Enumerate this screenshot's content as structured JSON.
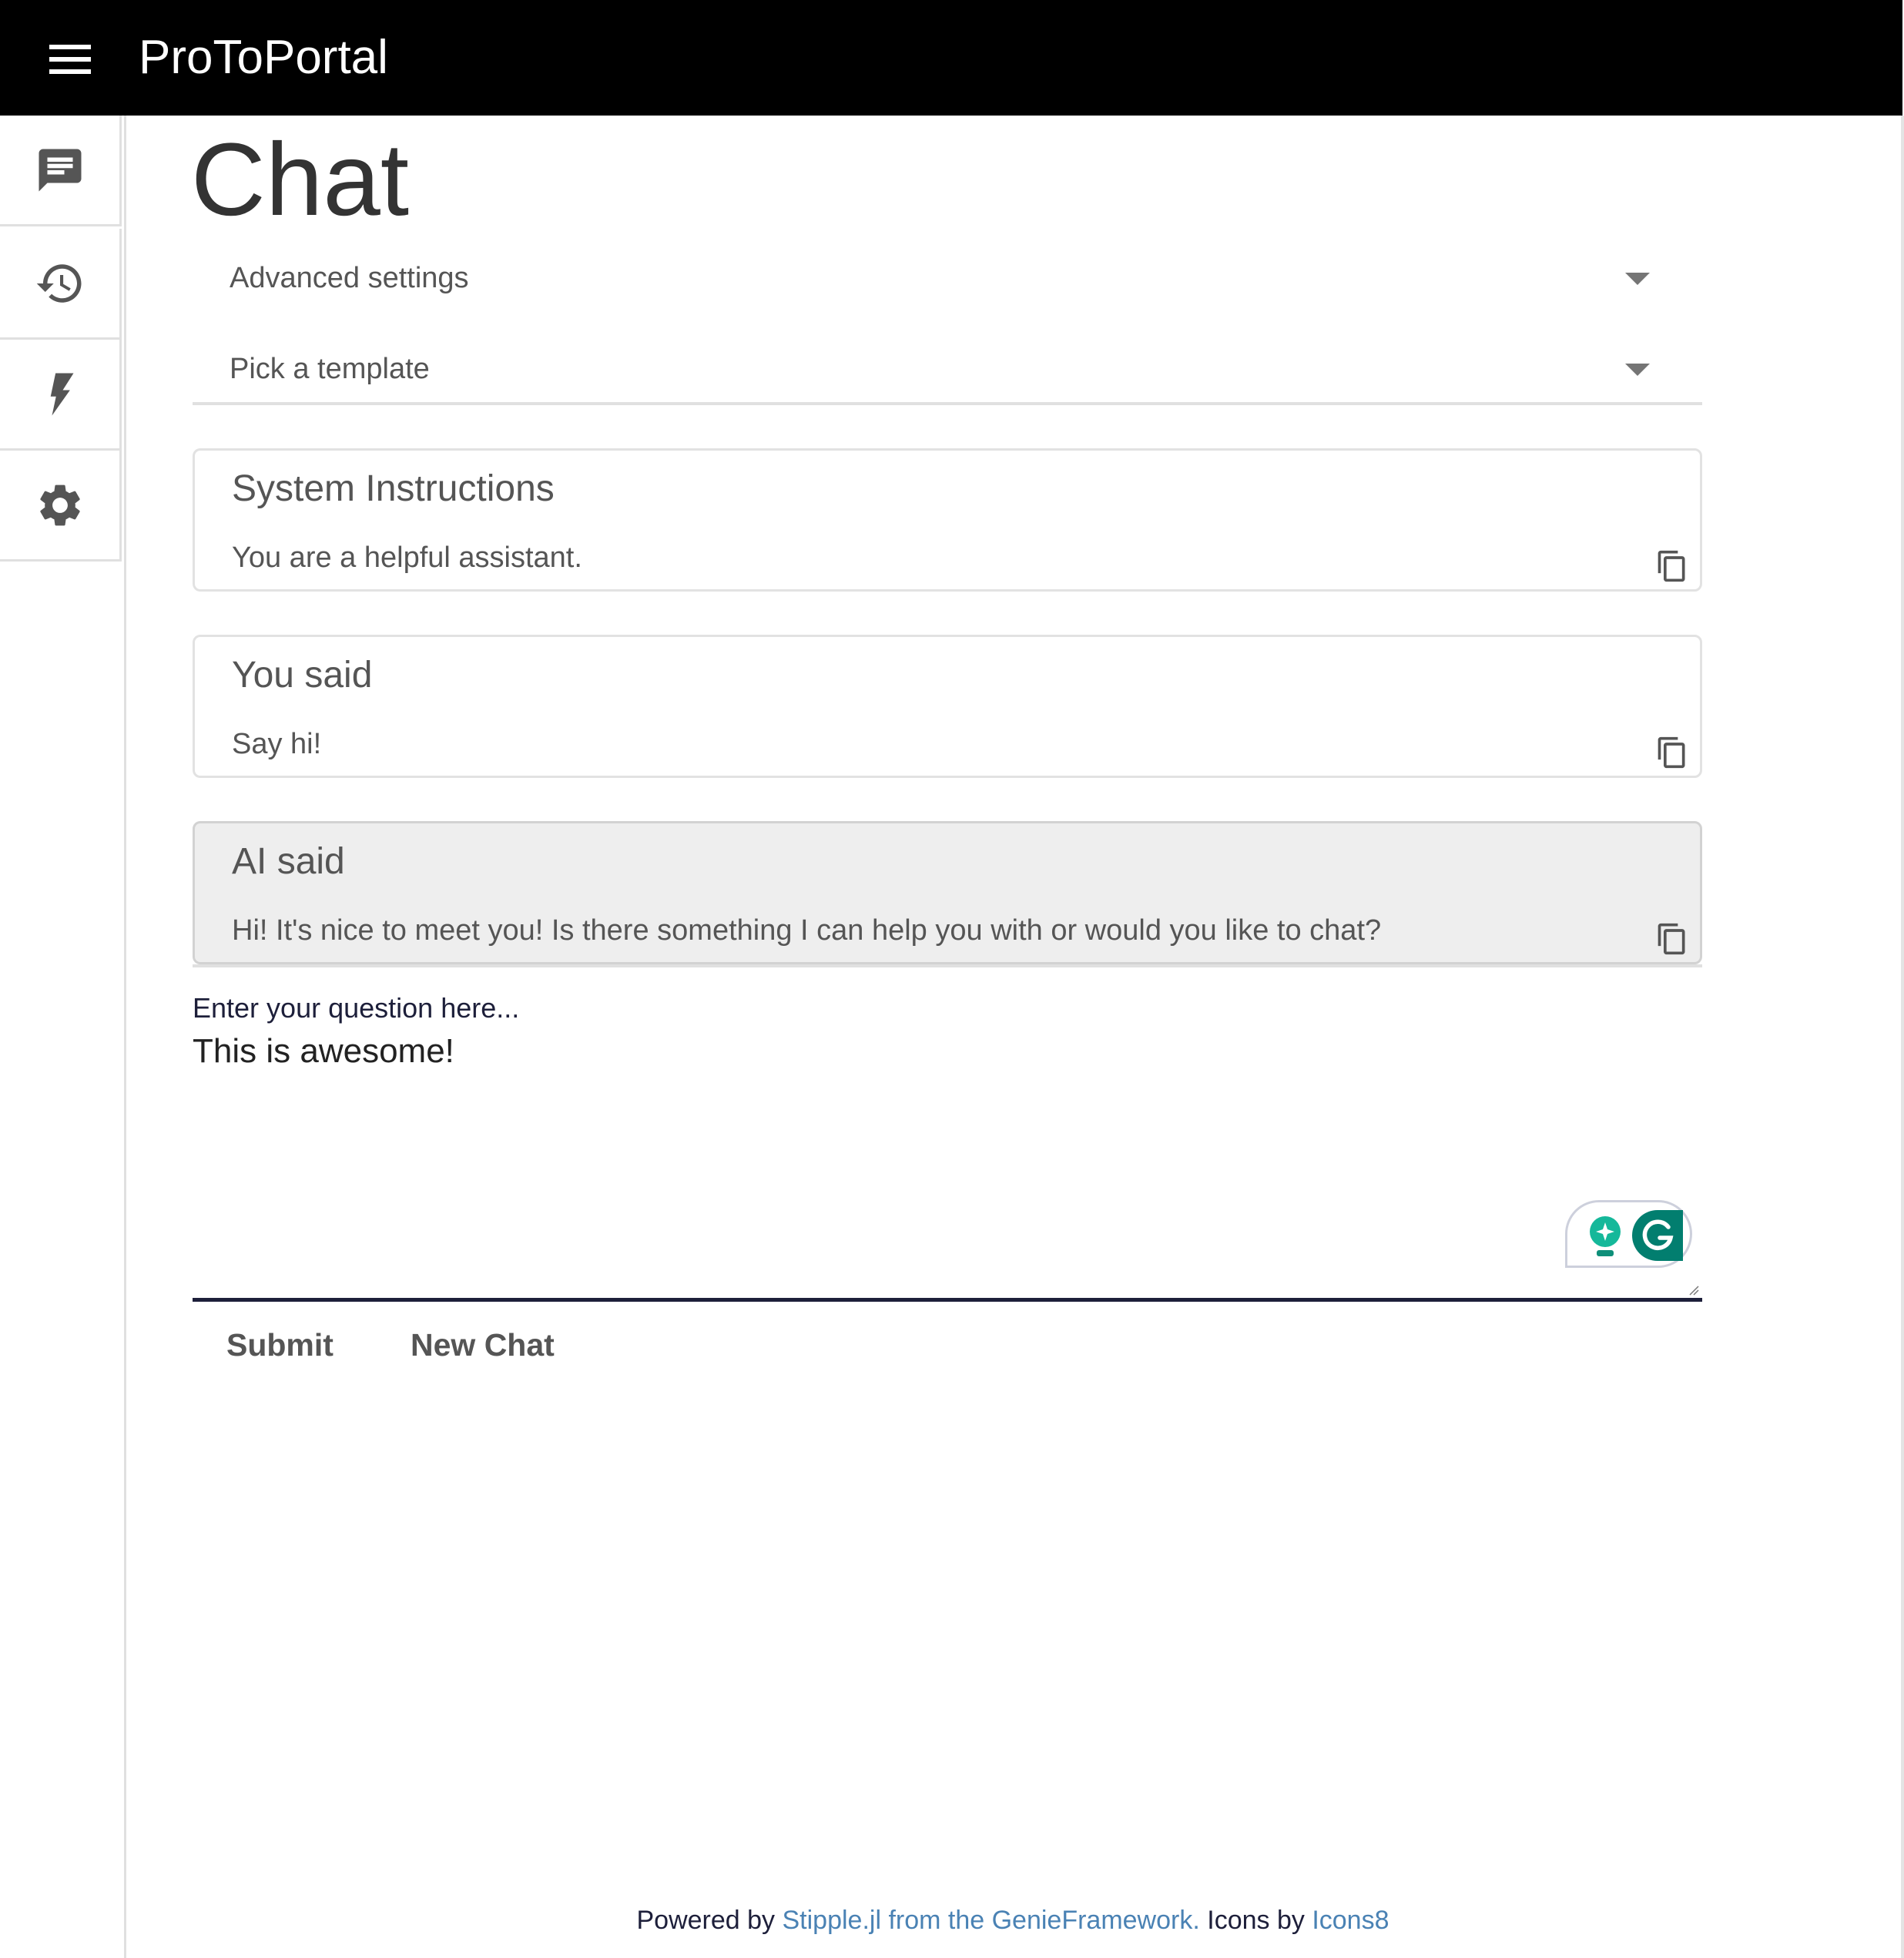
{
  "header": {
    "menu_icon": "hamburger-menu-icon",
    "title": "ProToPortal"
  },
  "sidebar": {
    "items": [
      {
        "name": "chat",
        "icon": "chat-icon",
        "active": true
      },
      {
        "name": "history",
        "icon": "history-icon"
      },
      {
        "name": "templates",
        "icon": "lightning-icon"
      },
      {
        "name": "settings",
        "icon": "gear-icon"
      }
    ]
  },
  "main": {
    "title": "Chat",
    "advanced_settings": {
      "label": "Advanced settings",
      "icon": "caret-down-icon"
    },
    "template_picker": {
      "label": "Pick a template",
      "icon": "caret-down-icon"
    },
    "messages": [
      {
        "title": "System Instructions",
        "text": "You are a helpful assistant.",
        "icon": "copy-icon"
      },
      {
        "title": "You said",
        "text": "Say hi!",
        "icon": "copy-icon"
      },
      {
        "title": "AI said",
        "text": "Hi! It's nice to meet you! Is there something I can help you with or would you like to chat?",
        "icon": "copy-icon"
      }
    ],
    "question": {
      "label": "Enter your question here...",
      "value": "This is awesome!"
    },
    "buttons": {
      "submit": "Submit",
      "new_chat": "New Chat"
    }
  },
  "grammarly": {
    "icons": [
      "grammarly-assist-icon",
      "grammarly-icon"
    ],
    "colors": {
      "assist": "#15b89a",
      "brand": "#027e6f"
    }
  },
  "footer": {
    "prefix": "Powered by ",
    "link1": "Stipple.jl from the GenieFramework.",
    "middle": " Icons by ",
    "link2": "Icons8"
  },
  "colors": {
    "header_bg": "#000000",
    "link": "#4a82b4",
    "label": "#1d1f3a",
    "ai_card_bg": "#eeeeee"
  }
}
